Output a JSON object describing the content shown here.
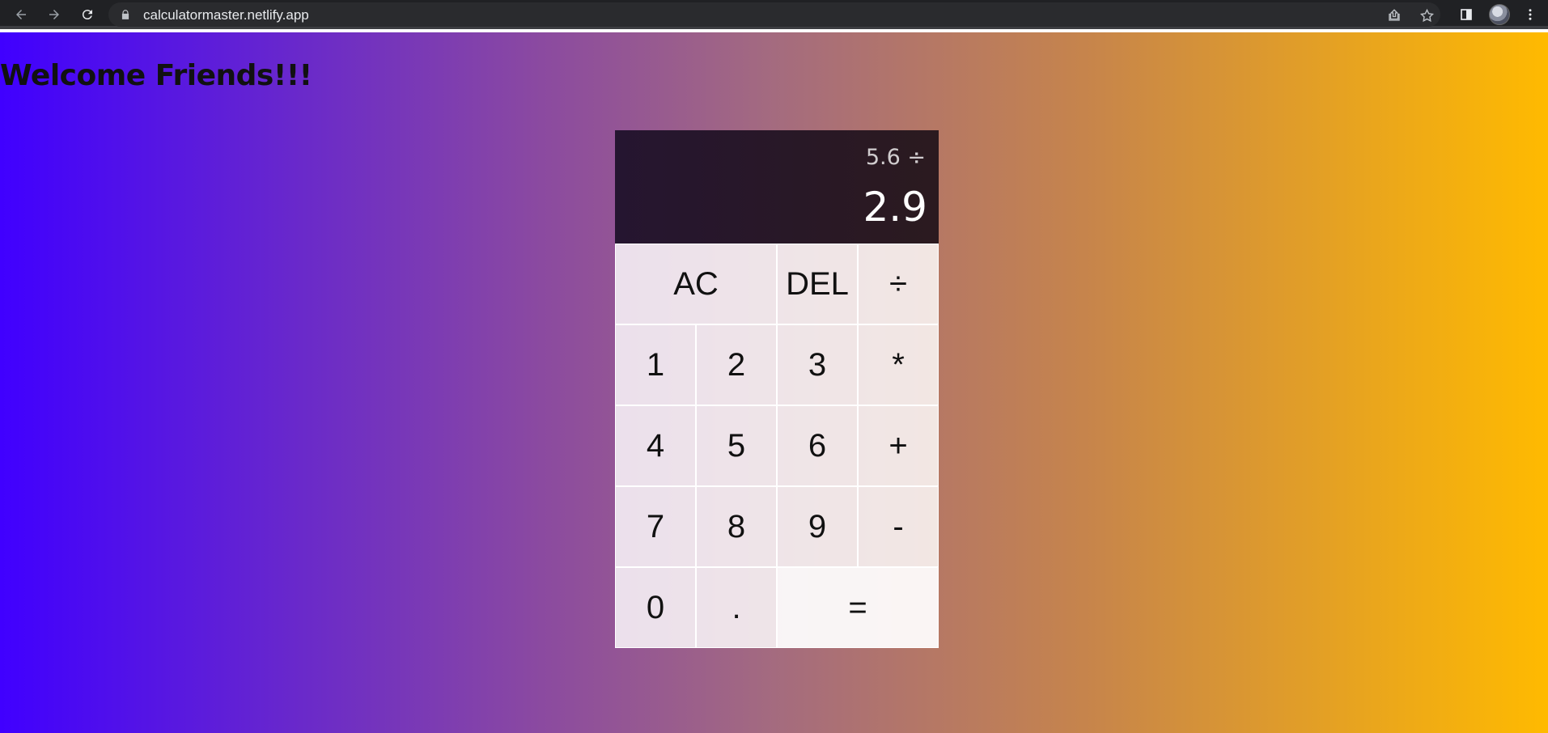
{
  "browser": {
    "url": "calculatormaster.netlify.app",
    "icons": [
      "back-arrow-icon",
      "forward-arrow-icon",
      "reload-icon",
      "lock-icon",
      "share-icon",
      "star-icon",
      "side-panel-icon",
      "kebab-menu-icon"
    ]
  },
  "page": {
    "title": "Welcome Friends!!!"
  },
  "calculator": {
    "previous_operand": "5.6 ÷",
    "current_operand": "2.9",
    "keys": [
      {
        "label": "AC",
        "name": "all-clear-button",
        "span": 2
      },
      {
        "label": "DEL",
        "name": "delete-button",
        "span": 1
      },
      {
        "label": "÷",
        "name": "divide-button",
        "span": 1
      },
      {
        "label": "1",
        "name": "digit-1-button",
        "span": 1
      },
      {
        "label": "2",
        "name": "digit-2-button",
        "span": 1
      },
      {
        "label": "3",
        "name": "digit-3-button",
        "span": 1
      },
      {
        "label": "*",
        "name": "multiply-button",
        "span": 1
      },
      {
        "label": "4",
        "name": "digit-4-button",
        "span": 1
      },
      {
        "label": "5",
        "name": "digit-5-button",
        "span": 1
      },
      {
        "label": "6",
        "name": "digit-6-button",
        "span": 1
      },
      {
        "label": "+",
        "name": "add-button",
        "span": 1
      },
      {
        "label": "7",
        "name": "digit-7-button",
        "span": 1
      },
      {
        "label": "8",
        "name": "digit-8-button",
        "span": 1
      },
      {
        "label": "9",
        "name": "digit-9-button",
        "span": 1
      },
      {
        "label": "-",
        "name": "subtract-button",
        "span": 1
      },
      {
        "label": "0",
        "name": "digit-0-button",
        "span": 1
      },
      {
        "label": ".",
        "name": "decimal-button",
        "span": 1
      },
      {
        "label": "=",
        "name": "equals-button",
        "span": 2
      }
    ]
  }
}
